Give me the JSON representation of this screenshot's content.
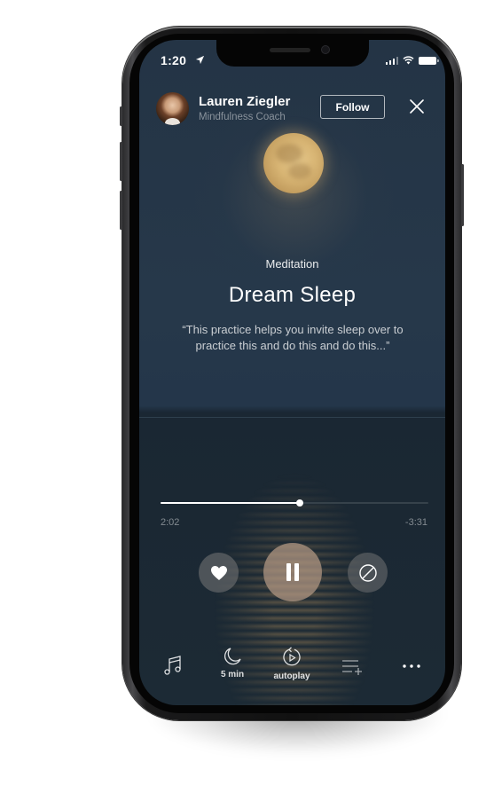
{
  "status_bar": {
    "time": "1:20"
  },
  "header": {
    "host_name": "Lauren Ziegler",
    "host_role": "Mindfulness Coach",
    "follow_label": "Follow"
  },
  "content": {
    "category": "Meditation",
    "title": "Dream Sleep",
    "description": "“This practice helps you invite sleep over to practice this and do this and do this...”"
  },
  "player": {
    "elapsed": "2:02",
    "remaining": "-3:31",
    "progress_fraction": 0.52,
    "state": "playing"
  },
  "bottom_bar": {
    "items": [
      {
        "icon": "music-note-icon",
        "label": ""
      },
      {
        "icon": "moon-icon",
        "label": "5 min"
      },
      {
        "icon": "autoplay-icon",
        "label": "autoplay"
      },
      {
        "icon": "add-to-queue-icon",
        "label": ""
      },
      {
        "icon": "more-icon",
        "label": ""
      }
    ]
  }
}
